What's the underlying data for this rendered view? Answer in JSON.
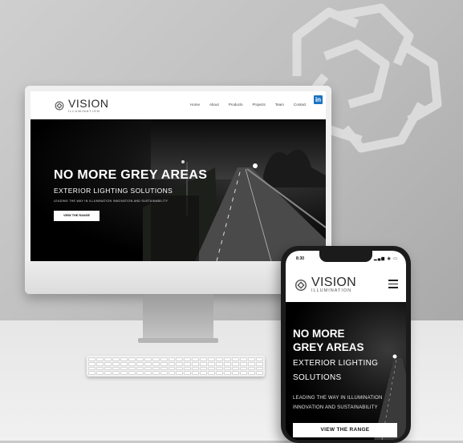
{
  "brand": {
    "name": "VISION",
    "subtitle": "ILLUMINATION"
  },
  "desktop_nav": {
    "items": [
      "Home",
      "About",
      "Products",
      "Projects",
      "Team",
      "Contact"
    ],
    "linkedin": "in"
  },
  "desktop_hero": {
    "title": "NO MORE GREY AREAS",
    "subtitle": "EXTERIOR LIGHTING SOLUTIONS",
    "tagline": "LEADING THE WAY IN ILLUMINATION INNOVATION AND SUSTAINABILITY",
    "button": "VIEW THE RANGE"
  },
  "phone": {
    "time": "8:30",
    "status_icons": "▂▄▆ ◉ ▭",
    "menu_icon": "hamburger-icon"
  },
  "mobile_hero": {
    "title_line1": "NO MORE",
    "title_line2": "GREY AREAS",
    "subtitle_line1": "EXTERIOR LIGHTING",
    "subtitle_line2": "SOLUTIONS",
    "tagline_line1": "LEADING THE WAY IN ILLUMINATION",
    "tagline_line2": "INNOVATION AND SUSTAINABILITY",
    "button": "VIEW THE RANGE"
  },
  "colors": {
    "linkedin": "#1a73c4",
    "hero_bg": "#000000",
    "button_bg": "#ffffff"
  }
}
